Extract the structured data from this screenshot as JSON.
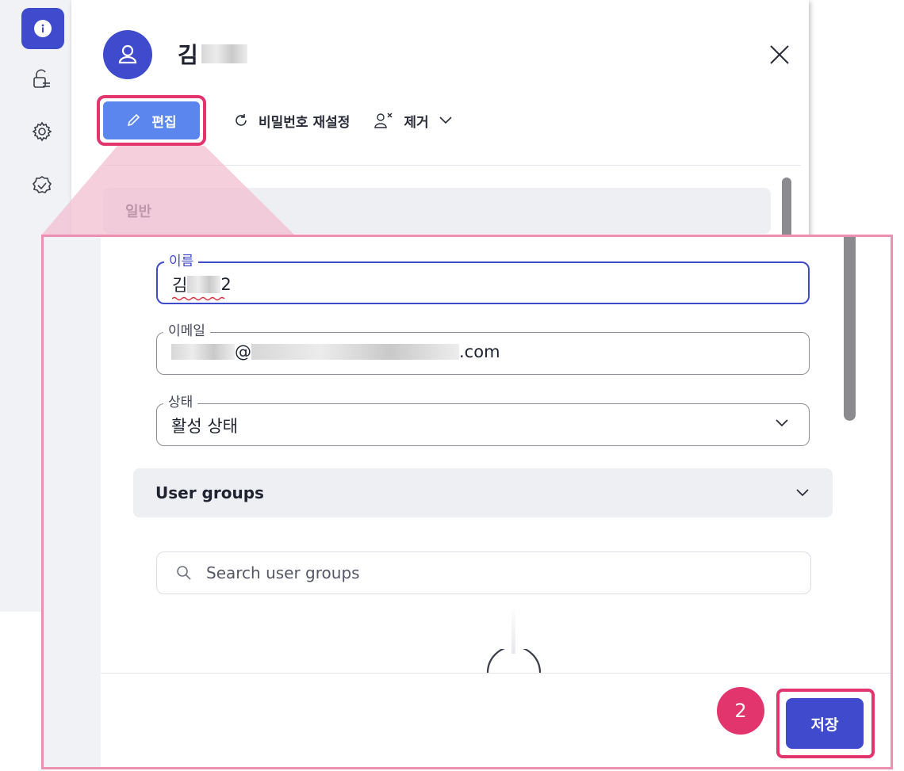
{
  "header": {
    "user_name_prefix": "김",
    "close_icon": "close-icon"
  },
  "toolbar": {
    "edit_label": "편집",
    "reset_password_label": "비밀번호 재설정",
    "remove_label": "제거"
  },
  "sections": {
    "general_label": "일반",
    "user_groups_label": "User groups"
  },
  "form": {
    "name_label": "이름",
    "name_value_prefix": "김",
    "name_value_suffix": "2",
    "email_label": "이메일",
    "email_at": "@",
    "email_suffix": ".com",
    "status_label": "상태",
    "status_value": "활성 상태"
  },
  "search": {
    "placeholder": "Search user groups"
  },
  "footer": {
    "step_badge": "2",
    "save_label": "저장"
  },
  "colors": {
    "accent": "#3f4bcc",
    "edit_button": "#5a86ee",
    "highlight": "#e2356e"
  }
}
